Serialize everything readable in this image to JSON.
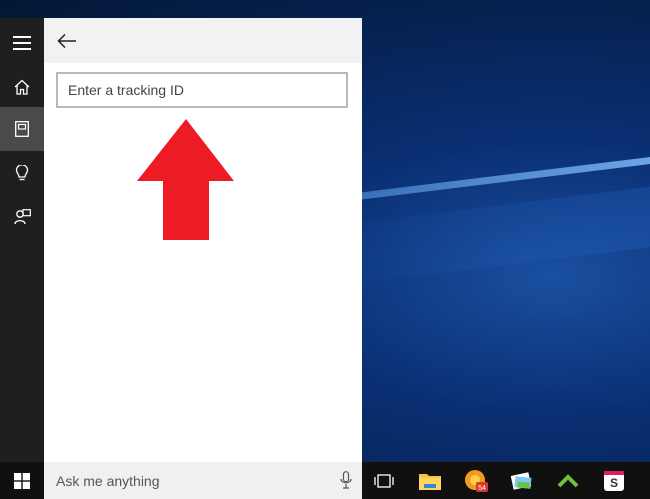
{
  "cortana": {
    "rail": {
      "items": [
        {
          "icon": "hamburger-menu-icon"
        },
        {
          "icon": "home-icon"
        },
        {
          "icon": "notebook-icon",
          "active": true
        },
        {
          "icon": "lightbulb-icon"
        },
        {
          "icon": "feedback-icon"
        }
      ]
    },
    "panel": {
      "back_icon": "back-arrow-icon",
      "tracking_placeholder": "Enter a tracking ID",
      "arrow_color": "#ed1c24"
    }
  },
  "taskbar": {
    "start_icon": "windows-logo-icon",
    "search_placeholder": "Ask me anything",
    "mic_icon": "microphone-icon",
    "apps": [
      {
        "name": "task-view-icon"
      },
      {
        "name": "file-explorer-icon"
      },
      {
        "name": "firefox-icon",
        "badge": "54"
      },
      {
        "name": "photos-icon"
      },
      {
        "name": "chevron-up-app-icon"
      },
      {
        "name": "slack-icon"
      }
    ]
  },
  "colors": {
    "accent_red": "#ed1c24",
    "rail_bg": "#1f1f1f",
    "taskbar_bg": "#101010"
  }
}
